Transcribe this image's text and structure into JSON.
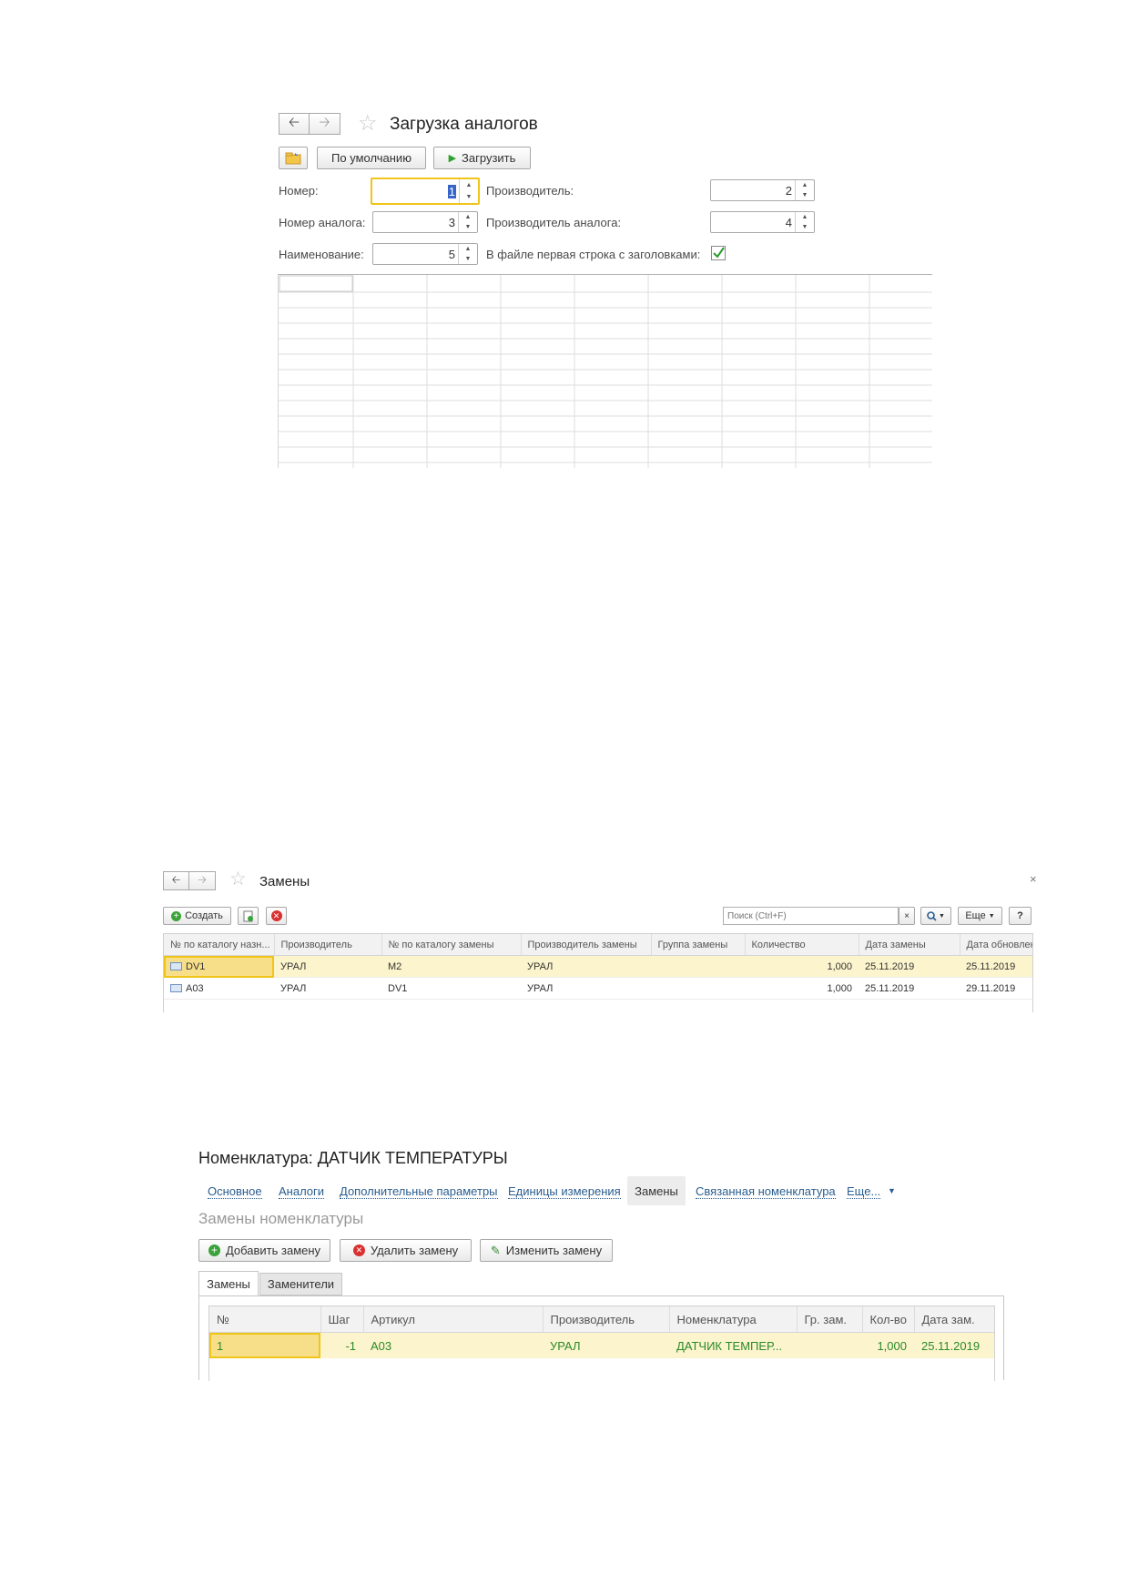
{
  "form1": {
    "title": "Загрузка аналогов",
    "default_button": "По умолчанию",
    "load_button": "Загрузить",
    "fields": {
      "number_label": "Номер:",
      "number_value": "1",
      "analog_number_label": "Номер аналога:",
      "analog_number_value": "3",
      "name_label": "Наименование:",
      "name_value": "5",
      "manufacturer_label": "Производитель:",
      "manufacturer_value": "2",
      "analog_manufacturer_label": "Производитель аналога:",
      "analog_manufacturer_value": "4",
      "header_row_label": "В файле первая строка с заголовками:",
      "header_row_checked": true
    }
  },
  "form2": {
    "title": "Замены",
    "create_button": "Создать",
    "search_placeholder": "Поиск (Ctrl+F)",
    "more_button": "Еще",
    "help_button": "?",
    "columns": [
      "№ по каталогу назн...",
      "Производитель",
      "№ по каталогу замены",
      "Производитель замены",
      "Группа замены",
      "Количество",
      "Дата замены",
      "Дата обновлен"
    ],
    "rows": [
      {
        "catalog_no": "DV1",
        "manufacturer": "УРАЛ",
        "replacement_no": "M2",
        "replacement_manufacturer": "УРАЛ",
        "group": "",
        "quantity": "1,000",
        "replace_date": "25.11.2019",
        "update_date": "25.11.2019"
      },
      {
        "catalog_no": "A03",
        "manufacturer": "УРАЛ",
        "replacement_no": "DV1",
        "replacement_manufacturer": "УРАЛ",
        "group": "",
        "quantity": "1,000",
        "replace_date": "25.11.2019",
        "update_date": "29.11.2019"
      }
    ]
  },
  "form3": {
    "title": "Номенклатура: ДАТЧИК ТЕМПЕРАТУРЫ",
    "tabs": [
      "Основное",
      "Аналоги",
      "Дополнительные параметры",
      "Единицы измерения",
      "Замены",
      "Связанная номенклатура",
      "Еще..."
    ],
    "active_tab": "Замены",
    "section_title": "Замены номенклатуры",
    "add_button": "Добавить замену",
    "delete_button": "Удалить замену",
    "edit_button": "Изменить замену",
    "subtabs": [
      "Замены",
      "Заменители"
    ],
    "columns": [
      "№",
      "Шаг",
      "Артикул",
      "Производитель",
      "Номенклатура",
      "Гр. зам.",
      "Кол-во",
      "Дата зам."
    ],
    "rows": [
      {
        "no": "1",
        "step": "-1",
        "article": "A03",
        "manufacturer": "УРАЛ",
        "nomenclature": "ДАТЧИК ТЕМПЕР...",
        "group": "",
        "qty": "1,000",
        "date": "25.11.2019"
      }
    ]
  }
}
